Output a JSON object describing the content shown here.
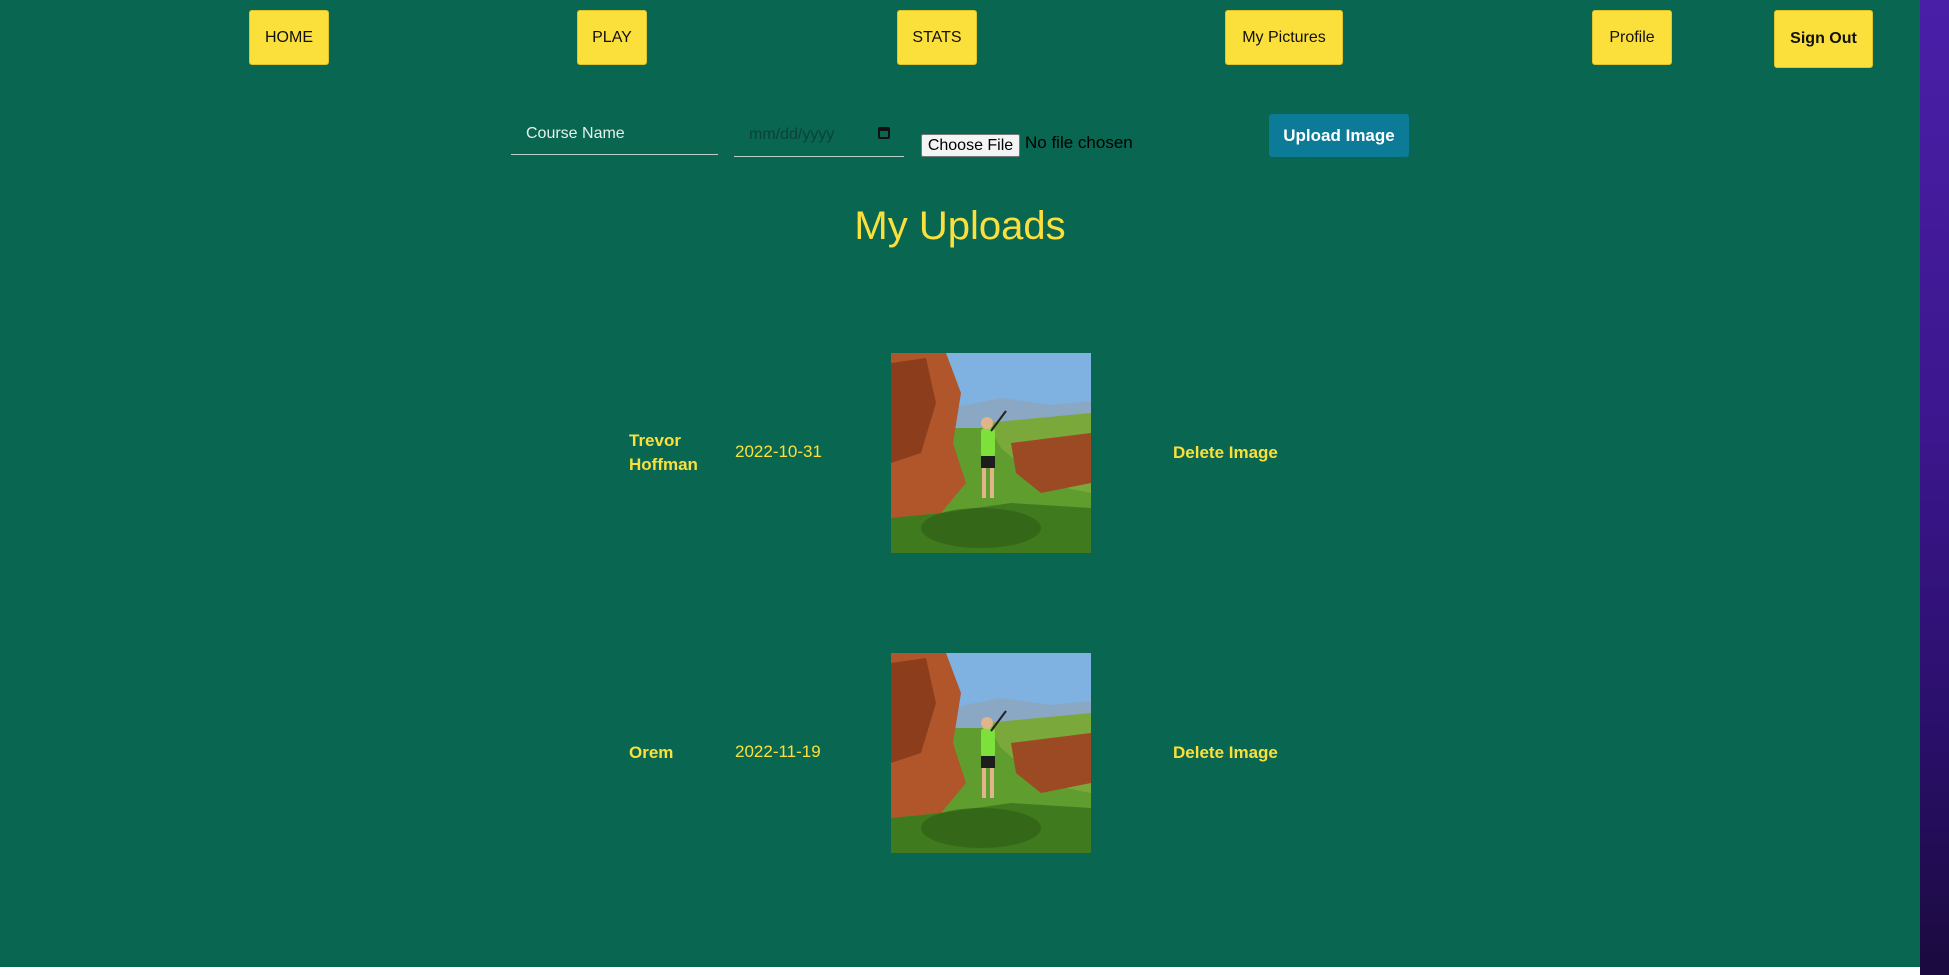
{
  "nav": {
    "home": "HOME",
    "play": "PLAY",
    "stats": "STATS",
    "pictures": "My Pictures",
    "profile": "Profile",
    "sign_out": "Sign Out"
  },
  "upload_form": {
    "course_placeholder": "Course Name",
    "date_placeholder": "mm/dd/yyyy",
    "choose_file_label": "Choose File",
    "file_status": "No file chosen",
    "upload_label": "Upload Image"
  },
  "page_title": "My Uploads",
  "uploads": [
    {
      "name": "Trevor Hoffman",
      "date": "2022-10-31",
      "delete_label": "Delete Image"
    },
    {
      "name": "Orem",
      "date": "2022-11-19",
      "delete_label": "Delete Image"
    }
  ],
  "colors": {
    "background": "#086651",
    "accent_yellow": "#fbe03c",
    "upload_button": "#0b7b97"
  },
  "icons": {
    "date_picker": "calendar-icon"
  }
}
